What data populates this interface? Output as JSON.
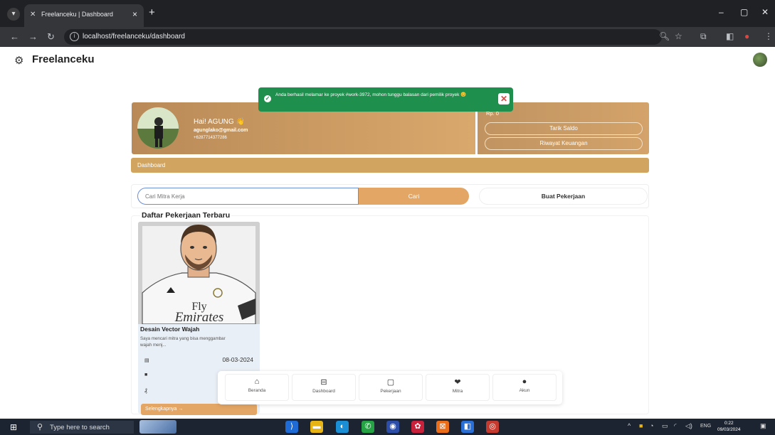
{
  "browser": {
    "tab_title": "Freelanceku | Dashboard",
    "tab_close": "×",
    "new_tab": "+",
    "url": "localhost/freelanceku/dashboard",
    "window_minimize": "–",
    "window_maximize": "▢",
    "window_close": "✕"
  },
  "app": {
    "brand": "Freelanceku"
  },
  "toast": {
    "message": "Anda berhasil melamar ke proyek #work-3972, mohon tunggu balasan dari pemilik proyek 😊",
    "close": "✕",
    "color": "#1f8f4e"
  },
  "profile": {
    "greeting": "Hai! AGUNG 👋",
    "email": "agunglako@gmail.com",
    "phone": "+6287714377286",
    "saldo": "Rp. 0",
    "withdraw_label": "Tarik Saldo",
    "history_label": "Riwayat Keuangan"
  },
  "dashboard_label": "Dashboard",
  "search": {
    "placeholder": "Cari Mitra Kerja",
    "button": "Cari",
    "create_button": "Buat Pekerjaan"
  },
  "jobs": {
    "section_title": "Daftar Pekerjaan Terbaru",
    "items": [
      {
        "name": "Desain Vector Wajah",
        "description": "Saya mencari mitra yang bisa menggambar wajah menj...",
        "date": "08-03-2024",
        "more_label": "Selengkapnya →",
        "image_text_1": "Fly",
        "image_text_2": "Emirates"
      }
    ]
  },
  "bottom_nav": [
    {
      "label": "Beranda",
      "icon": "home-icon"
    },
    {
      "label": "Dashboard",
      "icon": "dashboard-icon"
    },
    {
      "label": "Pekerjaan",
      "icon": "briefcase-icon"
    },
    {
      "label": "Mitra",
      "icon": "handshake-icon"
    },
    {
      "label": "Akun",
      "icon": "user-icon"
    }
  ],
  "taskbar": {
    "search_placeholder": "Type here to search",
    "language": "ENG",
    "time": "0:22",
    "date": "09/03/2024"
  },
  "colors": {
    "accent": "#e3a664",
    "card_gold": "#c59660",
    "dashboard_bar": "#d1a55f"
  }
}
